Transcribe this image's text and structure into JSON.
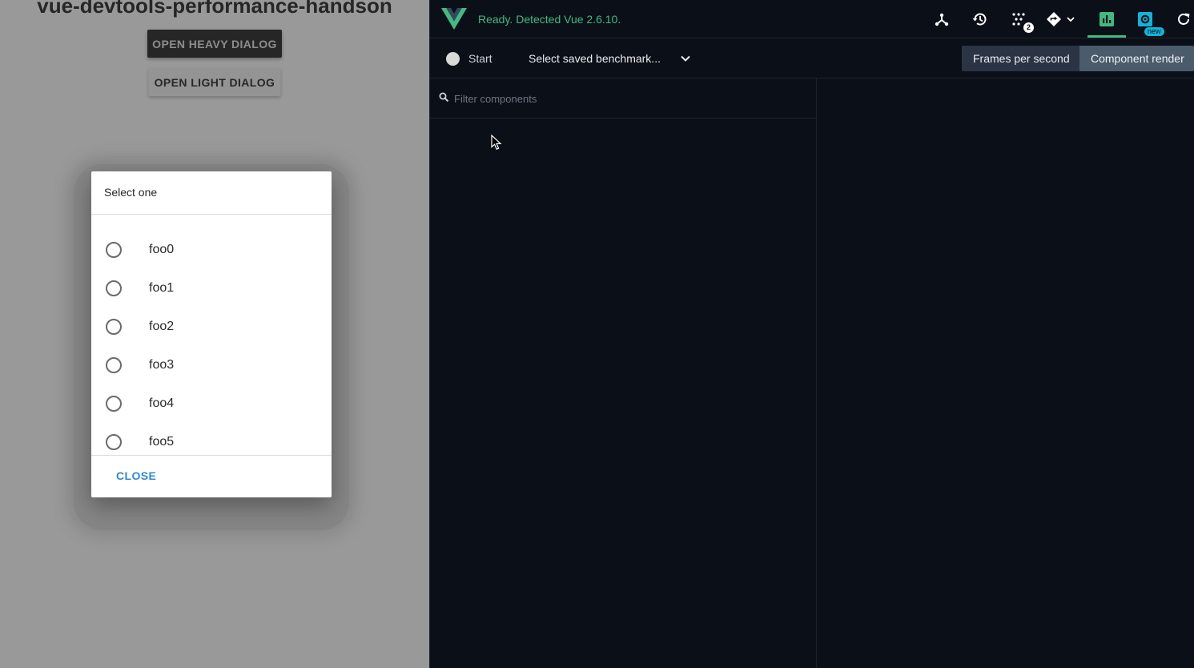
{
  "app": {
    "title": "vue-devtools-performance-handson",
    "open_heavy_label": "OPEN HEAVY DIALOG",
    "open_light_label": "OPEN LIGHT DIALOG",
    "dialog": {
      "title": "Select one",
      "options": [
        "foo0",
        "foo1",
        "foo2",
        "foo3",
        "foo4",
        "foo5"
      ],
      "close_label": "CLOSE"
    }
  },
  "devtools": {
    "status": "Ready. Detected Vue 2.6.10.",
    "toolbar_icons": [
      "components-tree-icon",
      "history-icon",
      "events-icon",
      "routing-icon",
      "performance-icon",
      "settings-icon",
      "refresh-icon"
    ],
    "events_count": "2",
    "new_badge": "new",
    "record_label": "Start",
    "benchmark_select": "Select saved benchmark...",
    "segments": [
      "Frames per second",
      "Component render"
    ],
    "filter_placeholder": "Filter components",
    "colors": {
      "accent": "#42b983",
      "background": "#0b0f17",
      "new_badge": "#10b4d9"
    }
  }
}
